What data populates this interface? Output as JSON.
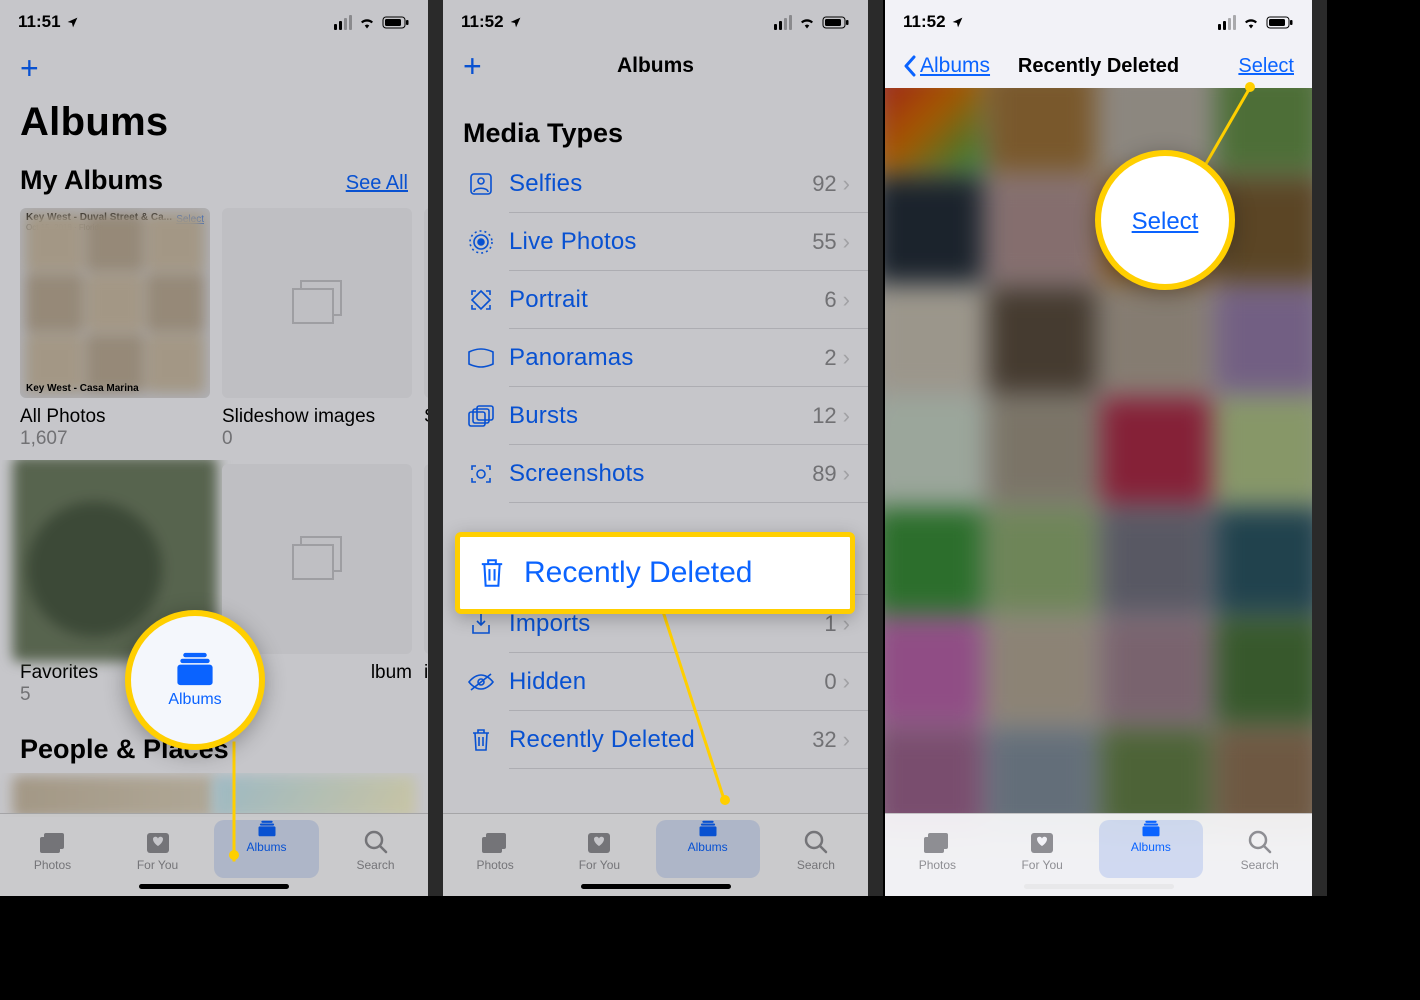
{
  "status": {
    "time1": "11:51",
    "time2": "11:52",
    "time3": "11:52"
  },
  "panel1": {
    "title": "Albums",
    "my_albums": "My Albums",
    "see_all": "See All",
    "people_places": "People & Places",
    "albums": [
      {
        "title": "All Photos",
        "count": "1,607",
        "thumb_caption": "Key West - Duval Street & Ca...",
        "thumb_sub": "Oct 15, 2018 · Florida",
        "thumb_select": "Select",
        "thumb_footer": "Key West - Casa Marina"
      },
      {
        "title": "Slideshow images",
        "count": "0"
      },
      {
        "title": "S",
        "count": ""
      },
      {
        "title": "Favorites",
        "count": "5"
      },
      {
        "title": "lbum",
        "count": ""
      },
      {
        "title": "iP",
        "count": ""
      }
    ]
  },
  "panel2": {
    "nav_title": "Albums",
    "section": "Media Types",
    "rows": [
      {
        "label": "Selfies",
        "count": "92"
      },
      {
        "label": "Live Photos",
        "count": "55"
      },
      {
        "label": "Portrait",
        "count": "6"
      },
      {
        "label": "Panoramas",
        "count": "2"
      },
      {
        "label": "Bursts",
        "count": "12"
      },
      {
        "label": "Screenshots",
        "count": "89"
      },
      {
        "label": "Imports",
        "count": "1"
      },
      {
        "label": "Hidden",
        "count": "0"
      },
      {
        "label": "Recently Deleted",
        "count": "32"
      }
    ],
    "callout": "Recently Deleted"
  },
  "panel3": {
    "back": "Albums",
    "title": "Recently Deleted",
    "select": "Select",
    "callout": "Select"
  },
  "tabs": {
    "photos": "Photos",
    "for_you": "For You",
    "albums": "Albums",
    "search": "Search"
  },
  "callout_albums": "Albums"
}
